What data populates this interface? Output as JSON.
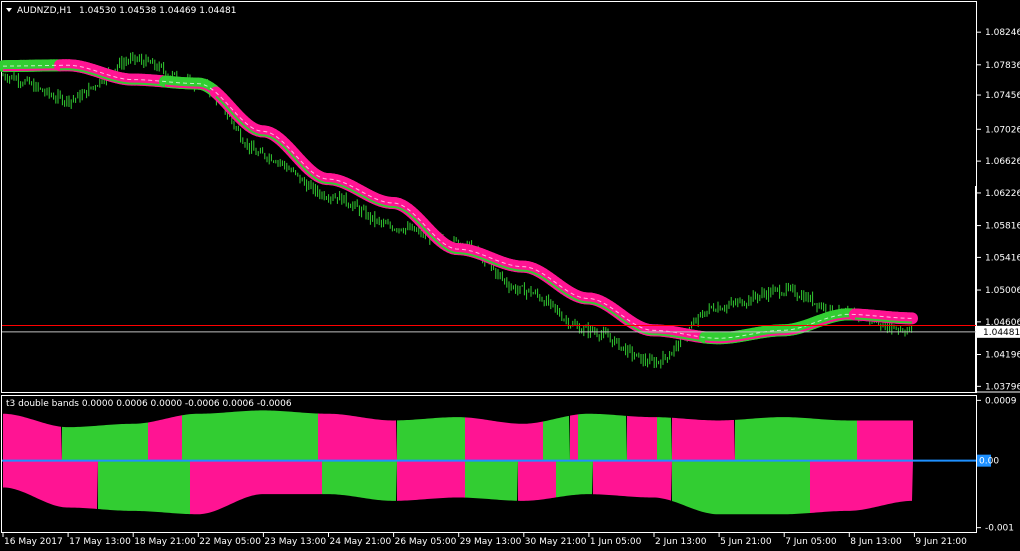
{
  "window": {
    "symbol_title": "AUDNZD,H1",
    "ohlc": "1.04530 1.04538 1.04469 1.04481",
    "menu_icon": "triangle-down-icon"
  },
  "price_axis": {
    "labels": [
      "1.08246",
      "1.07836",
      "1.07456",
      "1.07026",
      "1.06626",
      "1.06226",
      "1.05816",
      "1.05416",
      "1.05006",
      "1.04606",
      "1.04196",
      "1.03796"
    ],
    "ylim": [
      1.0375,
      1.086
    ],
    "current_price": 1.04481,
    "current_price_label": "1.04481",
    "red_line_price": 1.0456,
    "partial_label": "1.04606"
  },
  "time_axis": {
    "labels": [
      "16 May 2017",
      "17 May 13:00",
      "18 May 21:00",
      "22 May 05:00",
      "23 May 13:00",
      "24 May 21:00",
      "26 May 05:00",
      "29 May 13:00",
      "30 May 21:00",
      "1 Jun 05:00",
      "2 Jun 13:00",
      "5 Jun 21:00",
      "7 Jun 05:00",
      "8 Jun 13:00",
      "9 Jun 21:00"
    ]
  },
  "indicator": {
    "title": "t3 double bands 0.0000 0.0006 0.0000 -0.0006 0.0006 -0.0006",
    "axis_labels": [
      "0.0009",
      "0.00",
      "-0.001"
    ],
    "zero_label": "0.00",
    "ylim": [
      -0.00105,
      0.00095
    ]
  },
  "colors": {
    "bull": "#32cd32",
    "bear": "#ff1493",
    "candles": "#32cd32",
    "zero_line": "#1e90ff",
    "price_line": "#ff0000",
    "grid_text": "#ffffff"
  },
  "chart_data": [
    {
      "type": "line",
      "title": "AUDNZD,H1",
      "x": [
        "16 May 2017",
        "17 May 13:00",
        "18 May 21:00",
        "22 May 05:00",
        "23 May 13:00",
        "24 May 21:00",
        "26 May 05:00",
        "29 May 13:00",
        "30 May 21:00",
        "1 Jun 05:00",
        "2 Jun 13:00",
        "5 Jun 21:00",
        "7 Jun 05:00",
        "8 Jun 13:00",
        "9 Jun 21:00"
      ],
      "series": [
        {
          "values": [
            1.077,
            1.074,
            1.079,
            1.076,
            1.067,
            1.062,
            1.058,
            1.056,
            1.05,
            1.045,
            1.041,
            1.048,
            1.05,
            1.047,
            1.045
          ]
        },
        {
          "values": [
            1.0782,
            1.0783,
            1.0765,
            1.076,
            1.07,
            1.064,
            1.061,
            1.0552,
            1.053,
            1.049,
            1.045,
            1.044,
            1.045,
            1.047,
            1.0465
          ]
        }
      ],
      "ylim": [
        1.0375,
        1.086
      ]
    },
    {
      "type": "area",
      "title": "t3 double bands 0.0000 0.0006 0.0000 -0.0006 0.0006 -0.0006",
      "x": [
        "16 May 2017",
        "17 May 13:00",
        "18 May 21:00",
        "22 May 05:00",
        "23 May 13:00",
        "24 May 21:00",
        "26 May 05:00",
        "29 May 13:00",
        "30 May 21:00",
        "1 Jun 05:00",
        "2 Jun 13:00",
        "5 Jun 21:00",
        "7 Jun 05:00",
        "8 Jun 13:00",
        "9 Jun 21:00"
      ],
      "series": [
        {
          "values": [
            0.0007,
            0.0005,
            0.00055,
            0.0007,
            0.00075,
            0.0007,
            0.0006,
            0.00065,
            0.00055,
            0.0007,
            0.00065,
            0.0006,
            0.00065,
            0.0006,
            0.0006
          ]
        },
        {
          "values": [
            -0.0004,
            -0.0007,
            -0.00075,
            -0.0008,
            -0.0005,
            -0.0005,
            -0.0006,
            -0.00055,
            -0.0006,
            -0.0005,
            -0.00055,
            -0.0008,
            -0.0008,
            -0.00075,
            -0.0006
          ]
        }
      ],
      "ylim": [
        -0.00105,
        0.00095
      ]
    }
  ]
}
